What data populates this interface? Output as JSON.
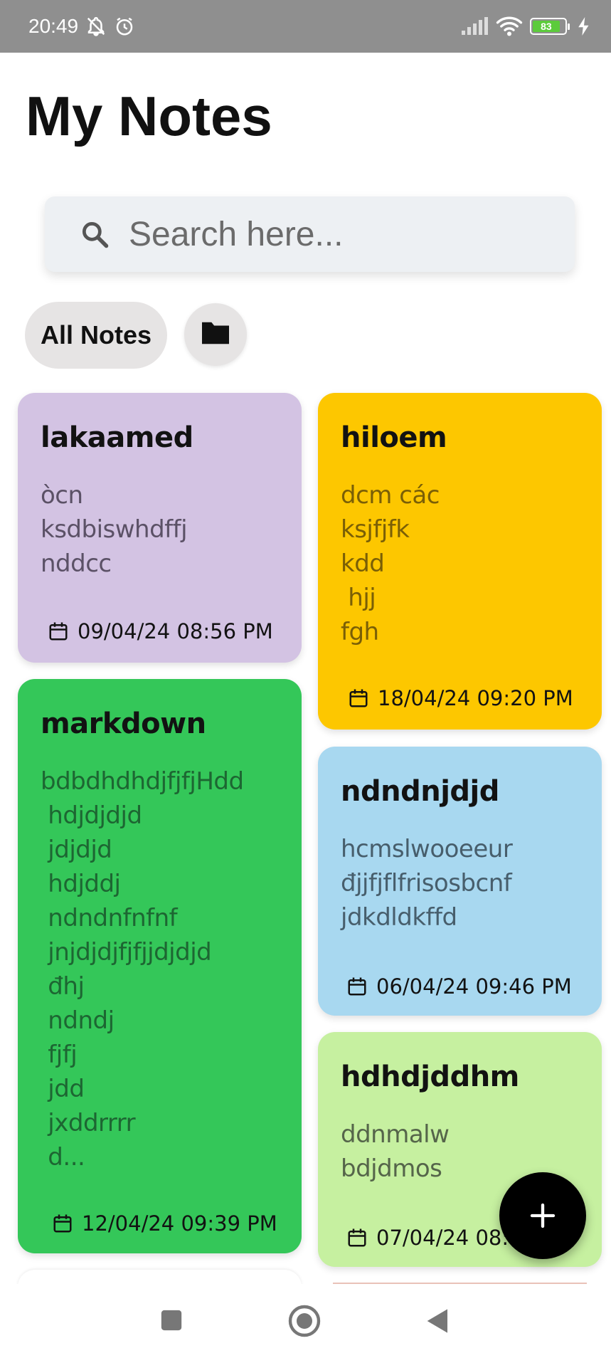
{
  "status_bar": {
    "time": "20:49",
    "battery": "83",
    "icons": [
      "notifications-off-icon",
      "alarm-icon",
      "signal-icon",
      "wifi-icon",
      "battery-icon",
      "charging-icon"
    ]
  },
  "header": {
    "title": "My Notes"
  },
  "search": {
    "placeholder": "Search here...",
    "value": "",
    "icon": "search-icon"
  },
  "filters": {
    "all_label": "All Notes",
    "folder_icon": "folder-icon"
  },
  "notes": [
    {
      "title": "lakaamed",
      "body": "òcn\nksdbiswhdffj\nnddcc",
      "date": "09/04/24 08:56 PM",
      "color": "#d3c3e3"
    },
    {
      "title": "hiloem",
      "body": "dcm các\nksjfjfk\nkdd\n hjj\nfgh",
      "date": "18/04/24 09:20 PM",
      "color": "#fdc700"
    },
    {
      "title": "markdown",
      "body": "bdbdhdhdjfjfjHdd\n hdjdjdjd\n jdjdjd\n hdjddj\n ndndnfnfnf\n jnjdjdjfjfjjdjdjd\n đhj\n ndndj\n fjfj\n jdd\n jxddrrrr\n d...",
      "date": "12/04/24 09:39 PM",
      "color": "#34c759"
    },
    {
      "title": "ndndnjdjd",
      "body": "hcmslwooeeur\nđjjfjflfrisosbcnf\njdkdldkffd",
      "date": "06/04/24 09:46 PM",
      "color": "#a8d8f0"
    },
    {
      "title": "hdhdjddhm",
      "body": "ddnmalw\nbdjdmos",
      "date": "07/04/24 08:",
      "color": "#c6f0a0"
    }
  ],
  "fab": {
    "label": "+"
  },
  "nav_bar": {
    "items": [
      "recents-button",
      "home-button",
      "back-button"
    ]
  }
}
